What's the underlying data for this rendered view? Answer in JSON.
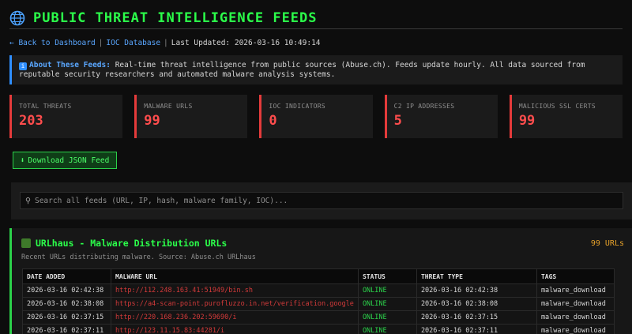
{
  "header": {
    "title": "PUBLIC THREAT INTELLIGENCE FEEDS",
    "icon": "globe-icon"
  },
  "nav": {
    "back_label": "← Back to Dashboard",
    "ioc_label": "IOC Database",
    "sep": "|",
    "updated": "Last Updated: 2026-03-16 10:49:14"
  },
  "info": {
    "label": "About These Feeds:",
    "text": "Real-time threat intelligence from public sources (Abuse.ch). Feeds update hourly. All data sourced from reputable security researchers and automated malware analysis systems."
  },
  "stats": [
    {
      "label": "TOTAL THREATS",
      "value": "203"
    },
    {
      "label": "MALWARE URLS",
      "value": "99"
    },
    {
      "label": "IOC INDICATORS",
      "value": "0"
    },
    {
      "label": "C2 IP ADDRESSES",
      "value": "5"
    },
    {
      "label": "MALICIOUS SSL CERTS",
      "value": "99"
    }
  ],
  "download": {
    "label": "Download JSON Feed"
  },
  "search": {
    "placeholder": "Search all feeds (URL, IP, hash, malware family, IOC)..."
  },
  "feed": {
    "title": "URLhaus - Malware Distribution URLs",
    "count": "99 URLs",
    "subtitle": "Recent URLs distributing malware. Source: Abuse.ch URLhaus",
    "columns": [
      "DATE ADDED",
      "MALWARE URL",
      "STATUS",
      "THREAT TYPE",
      "TAGS"
    ],
    "rows": [
      [
        "2026-03-16 02:42:38",
        "http://112.248.163.41:51949/bin.sh",
        "ONLINE",
        "2026-03-16 02:42:38",
        "malware_download"
      ],
      [
        "2026-03-16 02:38:08",
        "https://a4-scan-point.purofluzzo.in.net/verification.google",
        "ONLINE",
        "2026-03-16 02:38:08",
        "malware_download"
      ],
      [
        "2026-03-16 02:37:15",
        "http://220.168.236.202:59690/i",
        "ONLINE",
        "2026-03-16 02:37:15",
        "malware_download"
      ],
      [
        "2026-03-16 02:37:11",
        "http://123.11.15.83:44281/i",
        "ONLINE",
        "2026-03-16 02:37:11",
        "malware_download"
      ]
    ]
  },
  "colors": {
    "accent_green": "#2bff4a",
    "accent_red": "#ff4d4d",
    "accent_blue": "#5aa7ff",
    "accent_orange": "#e6a12a"
  }
}
